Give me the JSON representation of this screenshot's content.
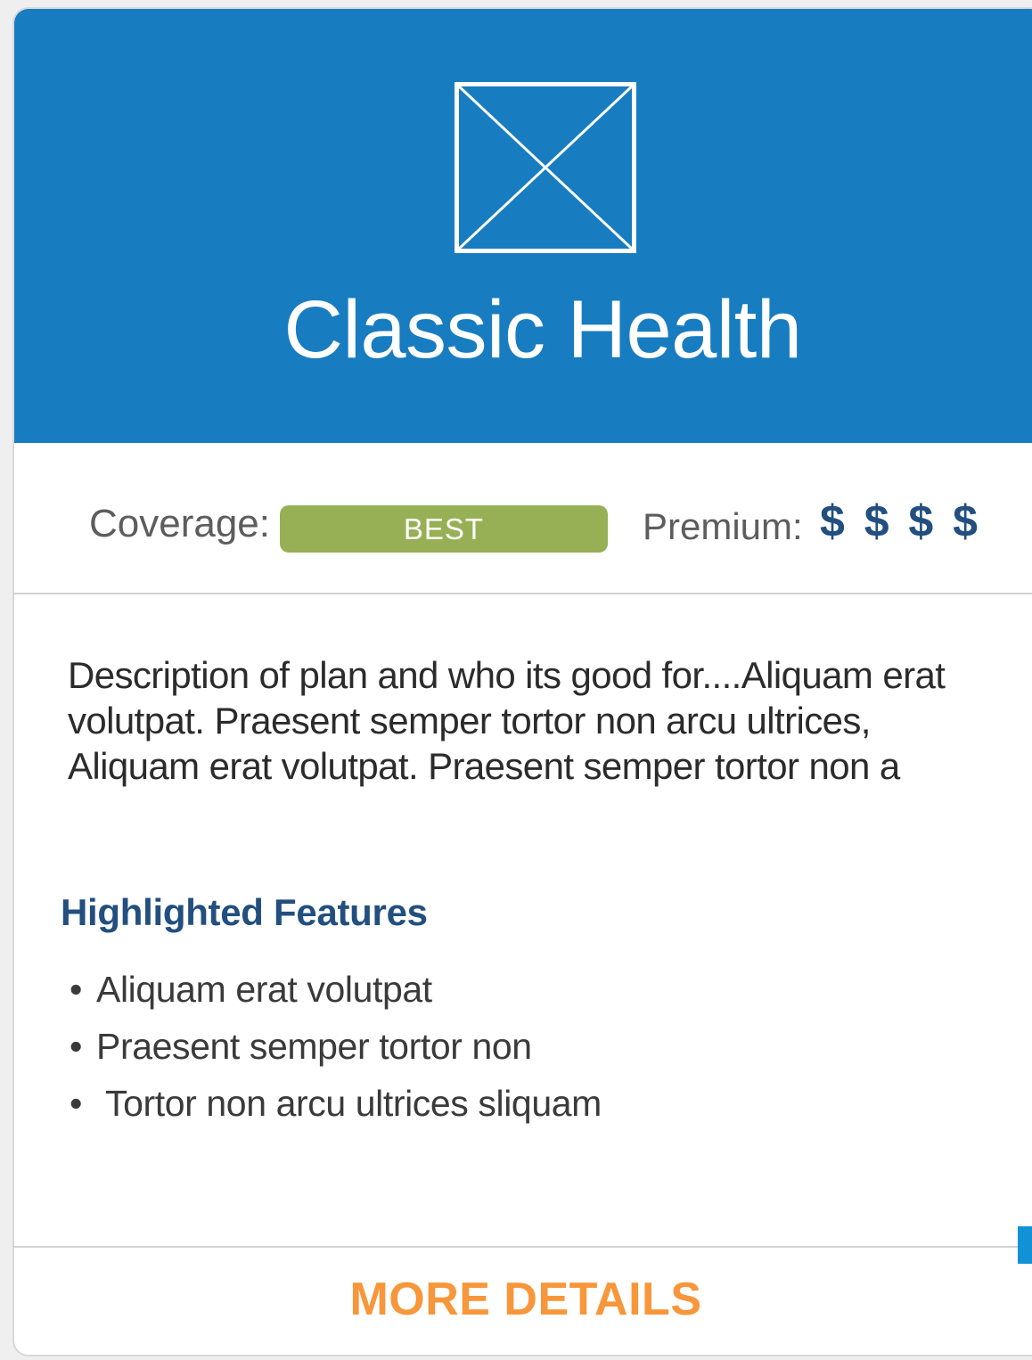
{
  "card": {
    "title": "Classic Health",
    "image_placeholder_icon": "image-placeholder-icon",
    "coverage": {
      "label": "Coverage:",
      "badge": "BEST",
      "badge_color": "#98b055"
    },
    "premium": {
      "label": "Premium:",
      "value": "$ $ $ $",
      "color": "#224f7f"
    },
    "description": "Description of plan and who its good for....Aliquam erat volutpat. Praesent semper tortor non arcu ultrices, Aliquam erat volutpat. Praesent semper tortor non a",
    "features_heading": "Highlighted Features",
    "features": [
      "Aliquam erat volutpat",
      "Praesent semper tortor non",
      "Tortor non arcu ultrices sliquam"
    ],
    "cta_label": "MORE DETAILS",
    "cta_color": "#f7963a",
    "header_color": "#187cc0"
  }
}
